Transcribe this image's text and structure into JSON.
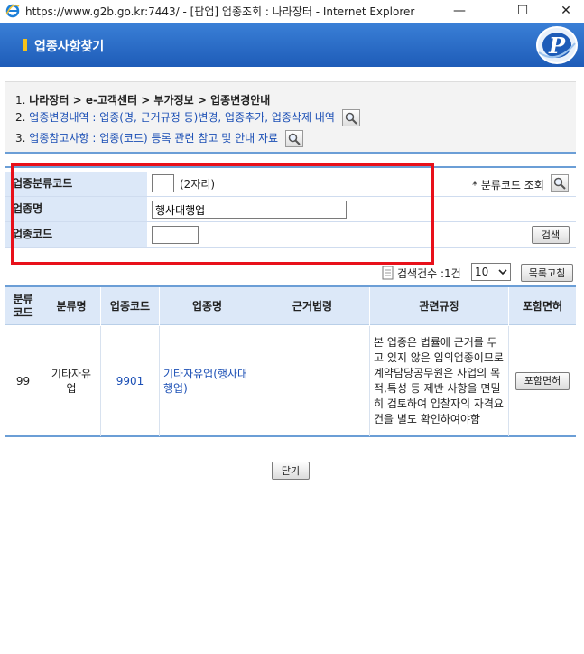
{
  "window": {
    "title": "https://www.g2b.go.kr:7443/ - [팝업] 업종조회 : 나라장터 - Internet Explorer",
    "minimize": "—",
    "maximize": "☐",
    "close": "✕"
  },
  "header": {
    "title": "업종사항찾기"
  },
  "steps": {
    "step1_num": "1.",
    "step1_text": "나라장터 > e-고객센터 > 부가정보 > 업종변경안내",
    "step2_num": "2.",
    "step2_text": "업종변경내역 : 업종(명, 근거규정 등)변경, 업종추가, 업종삭제 내역",
    "step3_num": "3.",
    "step3_text": "업종참고사항 : 업종(코드) 등록 관련 참고 및 안내 자료"
  },
  "form": {
    "class_code_label": "업종분류코드",
    "class_code_value": "",
    "class_code_hint": "(2자리)",
    "class_lookup_label": "* 분류코드 조회",
    "name_label": "업종명",
    "name_value": "행사대행업",
    "code_label": "업종코드",
    "code_value": "",
    "search_button": "검색"
  },
  "results": {
    "count_text": "검색건수 :1건",
    "page_size": "10",
    "refresh_button": "목록고침",
    "columns": [
      "분류\n코드",
      "분류명",
      "업종코드",
      "업종명",
      "근거법령",
      "관련규정",
      "포함면허"
    ],
    "rows": [
      {
        "class_code": "99",
        "class_name": "기타자유업",
        "code": "9901",
        "name": "기타자유업(행사대행업)",
        "law": "",
        "rule": "본 업종은 법률에 근거를 두고 있지 않은 임의업종이므로 계약담당공무원은 사업의 목적,특성 등 제반 사항을 면밀히 검토하여 입찰자의 자격요건을 별도 확인하여야함",
        "license_button": "포함면허"
      }
    ]
  },
  "footer": {
    "close_button": "닫기"
  },
  "colors": {
    "accent": "#1e5cb8",
    "header_bg": "#dce8f8",
    "highlight": "#e8101a"
  }
}
